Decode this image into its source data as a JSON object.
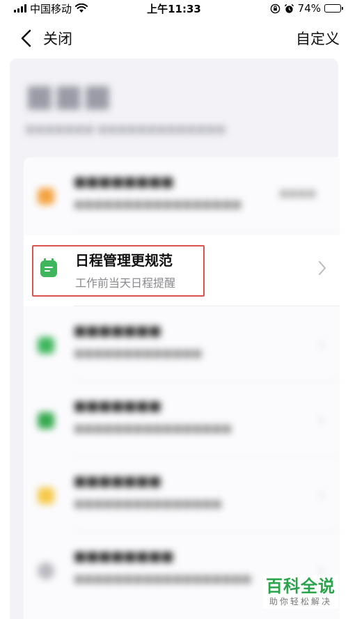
{
  "status_bar": {
    "carrier": "中国移动",
    "time": "上午11:33",
    "battery": "74%",
    "battery_level": 0.74
  },
  "nav": {
    "back_label": "关闭",
    "right_label": "自定义"
  },
  "focused_item": {
    "title": "日程管理更规范",
    "subtitle": "工作前当天日程提醒",
    "icon": "calendar-icon",
    "icon_color": "#3fb65c"
  },
  "colors": {
    "highlight_border": "#d9534f",
    "watermark_green": "#2aa34a"
  },
  "watermark": {
    "title": "百科全说",
    "subtitle": "助你轻松解决"
  }
}
